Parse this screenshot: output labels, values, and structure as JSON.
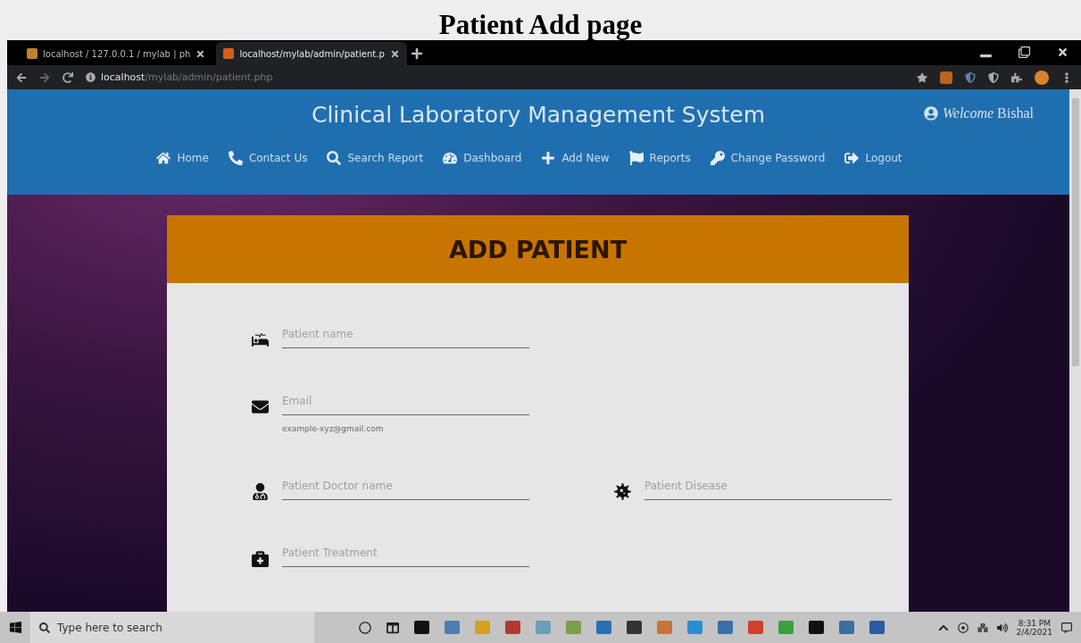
{
  "caption": "Patient Add page",
  "browser": {
    "tabs": [
      {
        "title": "localhost / 127.0.0.1 / mylab | ph",
        "selected": false
      },
      {
        "title": "localhost/mylab/admin/patient.p",
        "selected": true
      }
    ],
    "url_host": "localhost",
    "url_path": "/mylab/admin/patient.php"
  },
  "header": {
    "title": "Clinical Laboratory Management System",
    "welcome": "*Welcome* Bishal"
  },
  "nav": [
    "Home",
    "Contact Us",
    "Search Report",
    "Dashboard",
    "Add New",
    "Reports",
    "Change Password",
    "Logout"
  ],
  "card": {
    "title": "ADD PATIENT",
    "rows": [
      [
        {
          "placeholder": "Patient name"
        }
      ],
      [
        {
          "placeholder": "Email",
          "helper": "example-xyz@gmail.com"
        }
      ],
      [
        {
          "placeholder": "Patient Doctor name"
        },
        {
          "placeholder": "Patient Disease"
        }
      ],
      [
        {
          "placeholder": "Patient Treatment"
        }
      ]
    ]
  },
  "taskbar": {
    "search_placeholder": "Type here to search",
    "time": "8:31 PM",
    "date": "2/4/2021"
  }
}
